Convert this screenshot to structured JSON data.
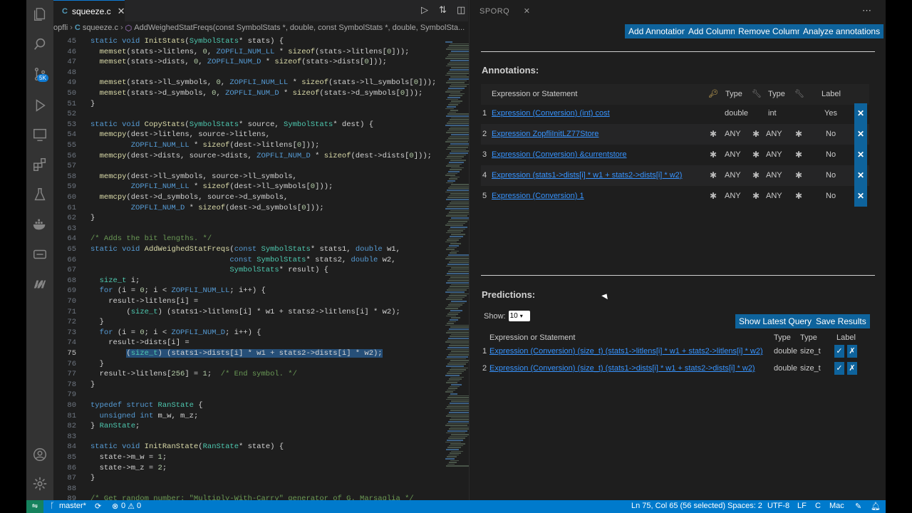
{
  "editor": {
    "tab_label": "squeeze.c",
    "breadcrumb": [
      "opfli",
      "squeeze.c",
      "AddWeighedStatFreqs(const SymbolStats *, double, const SymbolStats *, double, SymbolSta..."
    ],
    "lines": [
      {
        "n": "45",
        "t": "static void InitStats(SymbolStats* stats) {"
      },
      {
        "n": "46",
        "t": "  memset(stats->litlens, 0, ZOPFLI_NUM_LL * sizeof(stats->litlens[0]));"
      },
      {
        "n": "47",
        "t": "  memset(stats->dists, 0, ZOPFLI_NUM_D * sizeof(stats->dists[0]));"
      },
      {
        "n": "48",
        "t": ""
      },
      {
        "n": "49",
        "t": "  memset(stats->ll_symbols, 0, ZOPFLI_NUM_LL * sizeof(stats->ll_symbols[0]));"
      },
      {
        "n": "50",
        "t": "  memset(stats->d_symbols, 0, ZOPFLI_NUM_D * sizeof(stats->d_symbols[0]));"
      },
      {
        "n": "51",
        "t": "}"
      },
      {
        "n": "52",
        "t": ""
      },
      {
        "n": "53",
        "t": "static void CopyStats(SymbolStats* source, SymbolStats* dest) {"
      },
      {
        "n": "54",
        "t": "  memcpy(dest->litlens, source->litlens,"
      },
      {
        "n": "55",
        "t": "         ZOPFLI_NUM_LL * sizeof(dest->litlens[0]));"
      },
      {
        "n": "56",
        "t": "  memcpy(dest->dists, source->dists, ZOPFLI_NUM_D * sizeof(dest->dists[0]));"
      },
      {
        "n": "57",
        "t": ""
      },
      {
        "n": "58",
        "t": "  memcpy(dest->ll_symbols, source->ll_symbols,"
      },
      {
        "n": "59",
        "t": "         ZOPFLI_NUM_LL * sizeof(dest->ll_symbols[0]));"
      },
      {
        "n": "60",
        "t": "  memcpy(dest->d_symbols, source->d_symbols,"
      },
      {
        "n": "61",
        "t": "         ZOPFLI_NUM_D * sizeof(dest->d_symbols[0]));"
      },
      {
        "n": "62",
        "t": "}"
      },
      {
        "n": "63",
        "t": ""
      },
      {
        "n": "64",
        "t": "/* Adds the bit lengths. */"
      },
      {
        "n": "65",
        "t": "static void AddWeighedStatFreqs(const SymbolStats* stats1, double w1,"
      },
      {
        "n": "66",
        "t": "                               const SymbolStats* stats2, double w2,"
      },
      {
        "n": "67",
        "t": "                               SymbolStats* result) {"
      },
      {
        "n": "68",
        "t": "  size_t i;"
      },
      {
        "n": "69",
        "t": "  for (i = 0; i < ZOPFLI_NUM_LL; i++) {"
      },
      {
        "n": "70",
        "t": "    result->litlens[i] ="
      },
      {
        "n": "71",
        "t": "        (size_t) (stats1->litlens[i] * w1 + stats2->litlens[i] * w2);"
      },
      {
        "n": "72",
        "t": "  }"
      },
      {
        "n": "73",
        "t": "  for (i = 0; i < ZOPFLI_NUM_D; i++) {"
      },
      {
        "n": "74",
        "t": "    result->dists[i] ="
      },
      {
        "n": "75",
        "t": "        (size_t) (stats1->dists[i] * w1 + stats2->dists[i] * w2);"
      },
      {
        "n": "76",
        "t": "  }"
      },
      {
        "n": "77",
        "t": "  result->litlens[256] = 1;  /* End symbol. */"
      },
      {
        "n": "78",
        "t": "}"
      },
      {
        "n": "79",
        "t": ""
      },
      {
        "n": "80",
        "t": "typedef struct RanState {"
      },
      {
        "n": "81",
        "t": "  unsigned int m_w, m_z;"
      },
      {
        "n": "82",
        "t": "} RanState;"
      },
      {
        "n": "83",
        "t": ""
      },
      {
        "n": "84",
        "t": "static void InitRanState(RanState* state) {"
      },
      {
        "n": "85",
        "t": "  state->m_w = 1;"
      },
      {
        "n": "86",
        "t": "  state->m_z = 2;"
      },
      {
        "n": "87",
        "t": "}"
      },
      {
        "n": "88",
        "t": ""
      },
      {
        "n": "89",
        "t": "/* Get random number: \"Multiply-With-Carry\" generator of G. Marsaglia */"
      }
    ]
  },
  "panel": {
    "tab_label": "SPORQ",
    "buttons": [
      "Add Annotation",
      "Add Column",
      "Remove Column",
      "Analyze annotations"
    ],
    "annotations_title": "Annotations:",
    "annotations_headers": [
      "Expression or Statement",
      "Type",
      "Type",
      "Label"
    ],
    "annotations": [
      {
        "n": "1",
        "expr": "Expression (Conversion) (int) cost",
        "type1": "double",
        "type2": "int",
        "label": "Yes"
      },
      {
        "n": "2",
        "expr": "Expression ZopfliInitLZ77Store",
        "type1": "ANY",
        "type2": "ANY",
        "label": "No"
      },
      {
        "n": "3",
        "expr": "Expression (Conversion) &currentstore",
        "type1": "ANY",
        "type2": "ANY",
        "label": "No"
      },
      {
        "n": "4",
        "expr": "Expression (stats1->dists[i] * w1 + stats2->dists[i] * w2)",
        "type1": "ANY",
        "type2": "ANY",
        "label": "No"
      },
      {
        "n": "5",
        "expr": "Expression (Conversion) 1",
        "type1": "ANY",
        "type2": "ANY",
        "label": "No"
      }
    ],
    "predictions_title": "Predictions:",
    "show_label": "Show:",
    "show_value": "10",
    "show_latest_query": "Show Latest Query",
    "save_results": "Save Results",
    "predictions_headers": [
      "Expression or Statement",
      "Type",
      "Type",
      "Label"
    ],
    "predictions": [
      {
        "n": "1",
        "expr": "Expression (Conversion) (size_t) (stats1->litlens[i] * w1 + stats2->litlens[i] * w2)",
        "type1": "double",
        "type2": "size_t"
      },
      {
        "n": "2",
        "expr": "Expression (Conversion) (size_t) (stats1->dists[i] * w1 + stats2->dists[i] * w2)",
        "type1": "double",
        "type2": "size_t"
      }
    ]
  },
  "status": {
    "branch": "master*",
    "problems": "0",
    "warnings": "0",
    "cursor": "Ln 75, Col 65 (56 selected)",
    "spaces": "Spaces: 2",
    "encoding": "UTF-8",
    "eol": "LF",
    "language": "C",
    "platform": "Mac"
  },
  "colors": {
    "accent": "#007acc",
    "button": "#0e639c",
    "link": "#3794ff"
  }
}
